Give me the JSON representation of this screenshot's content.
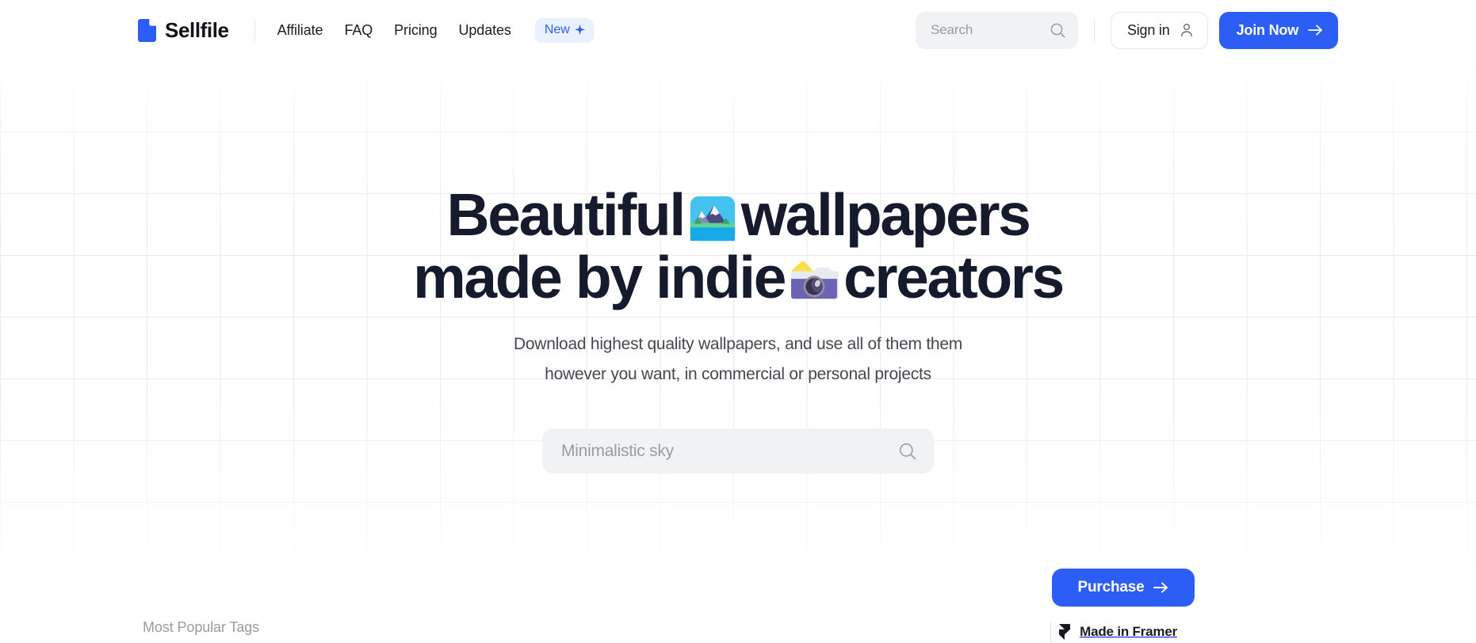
{
  "brand": {
    "name": "Sellfile",
    "logo_icon": "file-document-icon",
    "accent_color": "#2c5ef5"
  },
  "nav": {
    "links": [
      {
        "label": "Affiliate"
      },
      {
        "label": "FAQ"
      },
      {
        "label": "Pricing"
      },
      {
        "label": "Updates"
      }
    ],
    "badge": {
      "label": "New",
      "icon": "sparkle-icon",
      "bg_color": "#e8f1fd",
      "text_color": "#2c5ef5"
    },
    "search": {
      "placeholder": "Search",
      "value": "",
      "icon": "search-icon"
    },
    "sign_in": {
      "label": "Sign in",
      "icon": "user-icon"
    },
    "join_now": {
      "label": "Join Now",
      "icon": "arrow-right-icon",
      "bg_color": "#2c5ef5"
    }
  },
  "hero": {
    "title_line1_a": "Beautiful",
    "title_emoji1": "national-park-emoji",
    "title_line1_b": "wallpapers",
    "title_line2_a": "made by indie",
    "title_emoji2": "camera-flash-emoji",
    "title_line2_b": "creators",
    "subtitle": "Download highest quality wallpapers, and use all of them them however you want, in commercial or personal projects",
    "search": {
      "placeholder": "Minimalistic sky",
      "value": "",
      "icon": "search-icon"
    }
  },
  "bottom": {
    "tags_label": "Most Popular Tags",
    "purchase": {
      "label": "Purchase",
      "icon": "arrow-right-icon",
      "bg_color": "#2c5ef5"
    },
    "framer": {
      "label": "Made in Framer",
      "icon": "framer-logo-icon"
    }
  }
}
